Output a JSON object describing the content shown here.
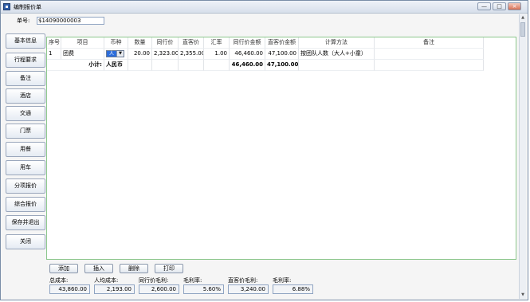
{
  "window": {
    "title": "编制报价单"
  },
  "header": {
    "order_label": "单号:",
    "order_value": "$14090000003"
  },
  "sidebar": {
    "items": [
      "基本信息",
      "行程要求",
      "备注",
      "酒店",
      "交通",
      "门票",
      "用餐",
      "用车",
      "分项报价",
      "综合报价",
      "保存并退出",
      "关闭"
    ]
  },
  "table": {
    "columns": [
      "序号",
      "项目",
      "币种",
      "数量",
      "同行价",
      "直客价",
      "汇率",
      "同行价金额",
      "直客价金额",
      "计算方法",
      "备注"
    ],
    "rows": [
      {
        "no": "1",
        "item": "团费",
        "currency": "人",
        "qty": "20.00",
        "peer_price": "2,323.00",
        "direct_price": "2,355.00",
        "rate": "1.00",
        "peer_amount": "46,460.00",
        "direct_amount": "47,100.00",
        "method": "按团队人数（大人+小童）",
        "remark": ""
      }
    ],
    "subtotal": {
      "label": "小计:",
      "currency": "人民币",
      "peer_amount": "46,460.00",
      "direct_amount": "47,100.00"
    }
  },
  "buttons": {
    "add": "添加",
    "insert": "插入",
    "delete": "删除",
    "print": "打印"
  },
  "stats": {
    "total_cost_label": "总成本:",
    "total_cost": "43,860.00",
    "per_cost_label": "人均成本:",
    "per_cost": "2,193.00",
    "peer_profit_label": "同行价毛利:",
    "peer_profit": "2,600.00",
    "peer_margin_label": "毛利率:",
    "peer_margin": "5.60%",
    "direct_profit_label": "直客价毛利:",
    "direct_profit": "3,240.00",
    "direct_margin_label": "毛利率:",
    "direct_margin": "6.88%"
  }
}
